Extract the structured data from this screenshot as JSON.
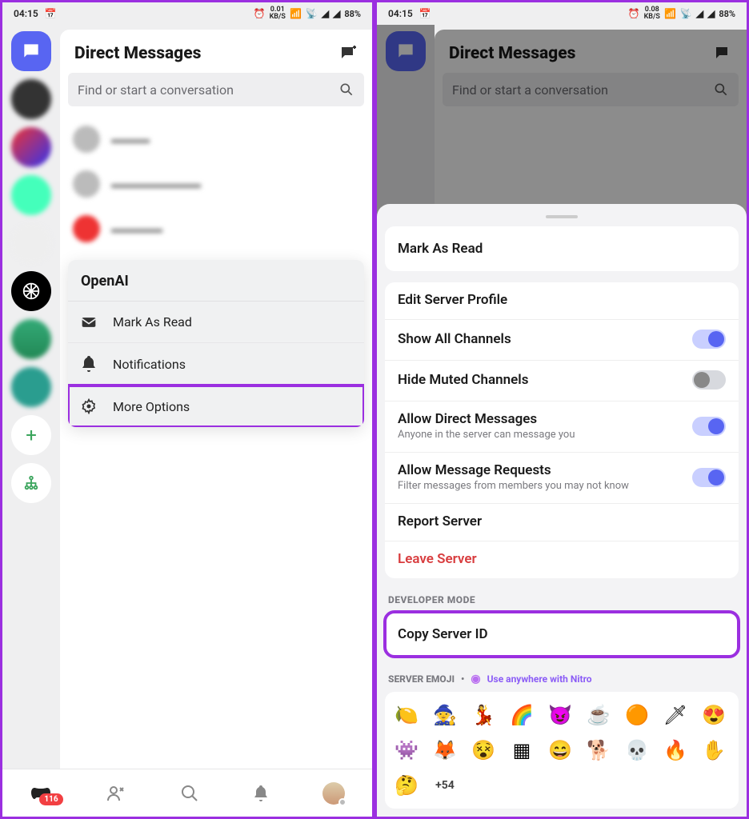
{
  "status": {
    "time": "04:15",
    "cal": "31",
    "kbs1": "0.01",
    "kbs2": "0.08",
    "kbs_unit": "KB/S",
    "batt": "88%"
  },
  "screen1": {
    "title": "Direct Messages",
    "search_placeholder": "Find or start a conversation",
    "dms": [
      "▬▬▬",
      "▬▬▬▬▬▬▬",
      "▬▬▬▬"
    ],
    "context": {
      "title": "OpenAI",
      "items": [
        "Mark As Read",
        "Notifications",
        "More Options"
      ]
    },
    "nav_badge": "116"
  },
  "screen2": {
    "mark_read": "Mark As Read",
    "edit_profile": "Edit Server Profile",
    "show_all": "Show All Channels",
    "hide_muted": "Hide Muted Channels",
    "allow_dm": "Allow Direct Messages",
    "allow_dm_sub": "Anyone in the server can message you",
    "allow_req": "Allow Message Requests",
    "allow_req_sub": "Filter messages from members you may not know",
    "report": "Report Server",
    "leave": "Leave Server",
    "dev_label": "DEVELOPER MODE",
    "copy_id": "Copy Server ID",
    "emoji_label": "SERVER EMOJI",
    "nitro_text": "Use anywhere with Nitro",
    "emojis": [
      "🍋",
      "🧙",
      "💃",
      "🌈",
      "😈",
      "☕",
      "🟠",
      "🗡",
      "😍",
      "👾",
      "🦊",
      "😵",
      "▦",
      "😄",
      "🐕",
      "💀",
      "🔥",
      "✋",
      "🤔"
    ],
    "emoji_more": "+54"
  }
}
